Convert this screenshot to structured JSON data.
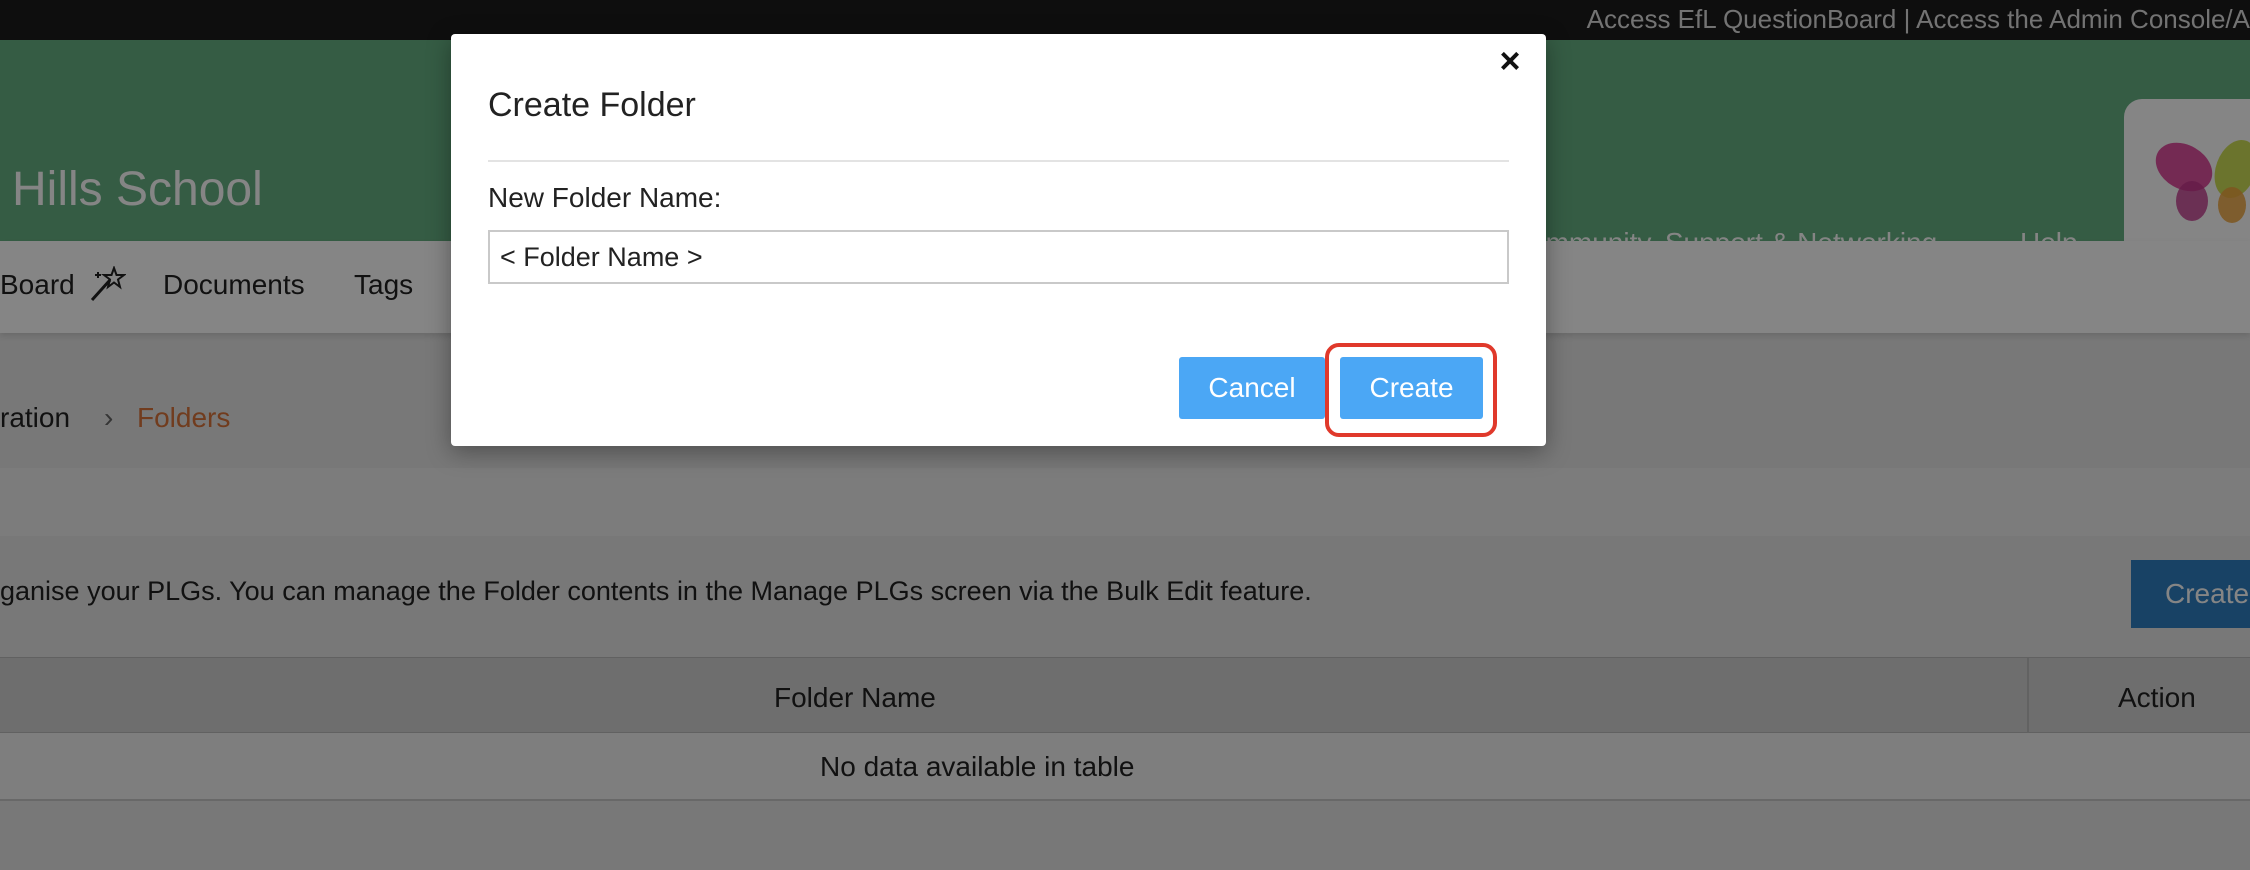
{
  "topbar": {
    "links_text": "Access EfL QuestionBoard | Access the Admin Console/A"
  },
  "header": {
    "school_name": "Hills School",
    "nav": [
      "ommunity, Support & Networking",
      "Help"
    ]
  },
  "navbar": {
    "items": [
      "Board",
      "Documents",
      "Tags"
    ]
  },
  "breadcrumb": {
    "parent": "ration",
    "separator": "›",
    "current": "Folders"
  },
  "main": {
    "info_text": "ganise your PLGs. You can manage the Folder contents in the Manage PLGs screen via the Bulk Edit feature.",
    "create_button": "Create",
    "table": {
      "columns": [
        "Folder Name",
        "Action"
      ],
      "empty_message": "No data available in table"
    }
  },
  "modal": {
    "close_label": "×",
    "title": "Create Folder",
    "field_label": "New Folder Name:",
    "field_value": "< Folder Name >",
    "cancel_label": "Cancel",
    "create_label": "Create"
  },
  "icons": {
    "close": "close-icon",
    "wand": "magic-wand-icon",
    "logo": "butterfly-logo-icon"
  },
  "colors": {
    "header_green": "#67b183",
    "breadcrumb_accent": "#d9733a",
    "modal_button_blue": "#4ba7f5",
    "main_button_blue": "#2e7fc2",
    "highlight_red": "#e0392b"
  }
}
